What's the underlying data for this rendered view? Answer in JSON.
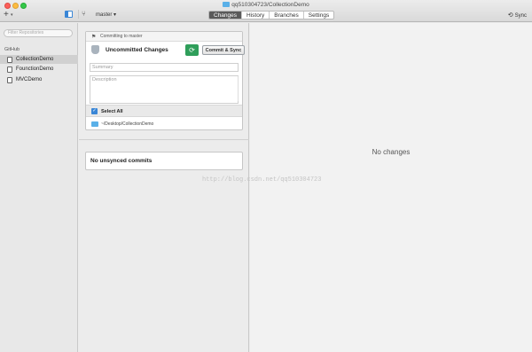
{
  "window": {
    "title": "qq510304723/CollectionDemo"
  },
  "toolbar": {
    "add_icon": "plus-icon",
    "branch_name": "master ▾",
    "tabs": [
      {
        "label": "Changes",
        "active": true
      },
      {
        "label": "History",
        "active": false
      },
      {
        "label": "Branches",
        "active": false
      },
      {
        "label": "Settings",
        "active": false
      }
    ],
    "sync_label": "Sync"
  },
  "sidebar": {
    "filter_placeholder": "Filter Repositories",
    "group_label": "GitHub",
    "repositories": [
      {
        "name": "CollectionDemo",
        "selected": true
      },
      {
        "name": "FounctionDemo",
        "selected": false
      },
      {
        "name": "MVCDemo",
        "selected": false
      }
    ]
  },
  "commit_panel": {
    "header": "Committing to master",
    "title": "Uncommitted Changes",
    "commit_button": "Commit & Sync",
    "summary_placeholder": "Summary",
    "description_placeholder": "Description",
    "select_all_label": "Select All",
    "select_all_checked": true,
    "repo_path": "~/Desktop/CollectionDemo"
  },
  "unsynced": {
    "label": "No unsynced commits"
  },
  "detail": {
    "empty_message": "No changes"
  },
  "watermark": "http://blog.csdn.net/qq510304723",
  "colors": {
    "accent_blue": "#3a86d6",
    "sync_green": "#2f9e5a",
    "folder_blue": "#5ab0e8"
  }
}
